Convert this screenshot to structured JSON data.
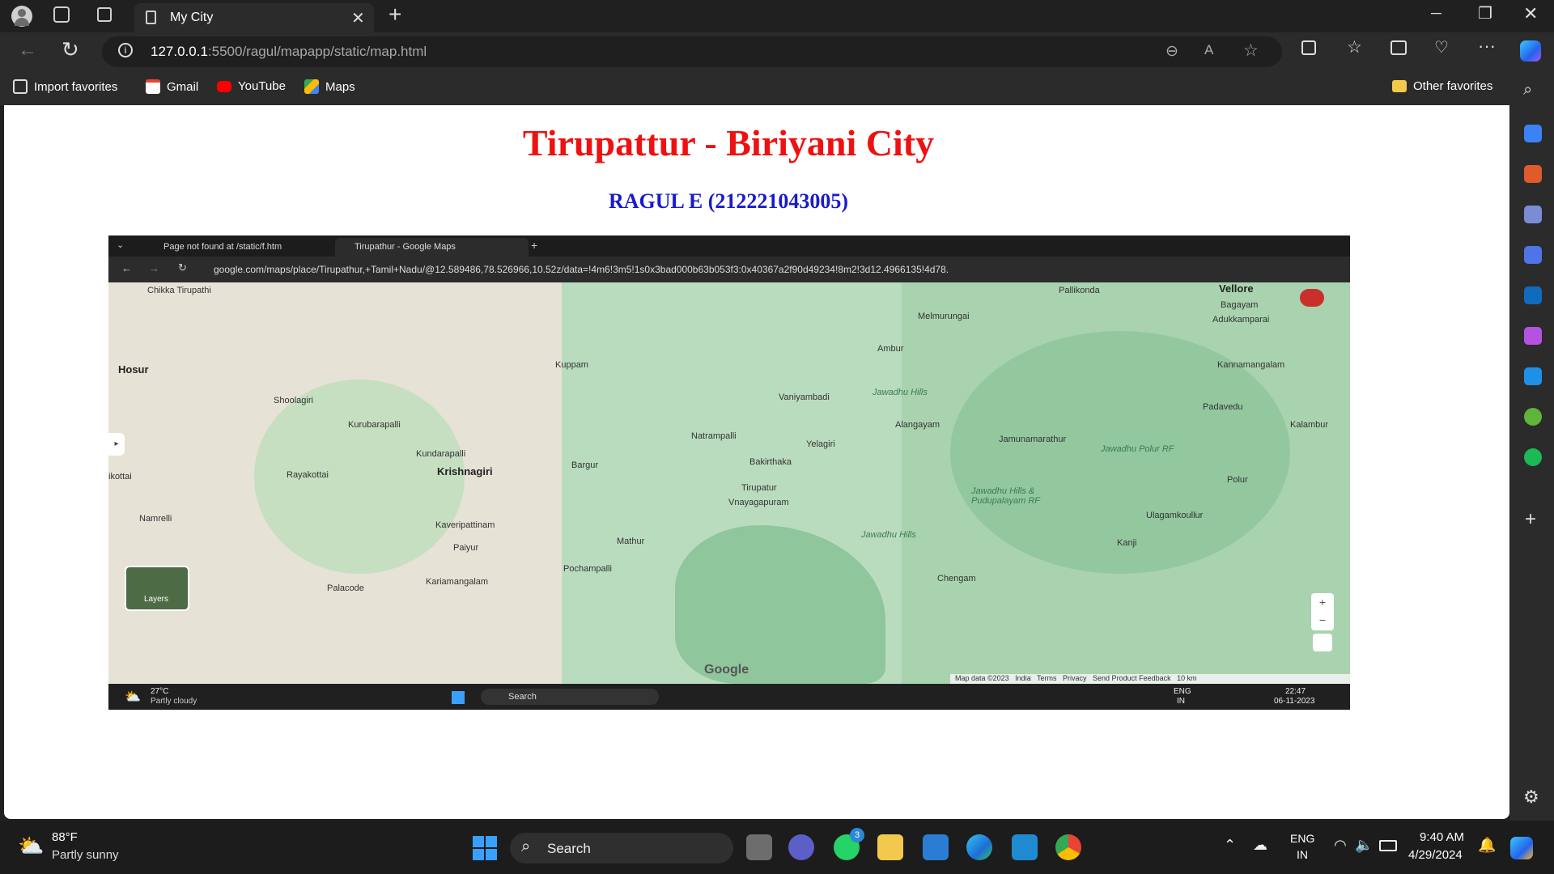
{
  "browser": {
    "tab_title": "My City",
    "url_host": "127.0.0.1",
    "url_path": ":5500/ragul/mapapp/static/map.html",
    "favorites": [
      "Import favorites",
      "Gmail",
      "YouTube",
      "Maps"
    ],
    "other_favorites": "Other favorites"
  },
  "page": {
    "heading": "Tirupattur - Biriyani City",
    "subheading": "RAGUL E (212221043005)"
  },
  "screenshot": {
    "tabs": [
      "Page not found at /static/f.htm",
      "Tirupathur - Google Maps"
    ],
    "url": "google.com/maps/place/Tirupathur,+Tamil+Nadu/@12.589486,78.526966,10.52z/data=!4m6!3m5!1s0x3bad000b63b053f3:0x40367a2f90d49234!8m2!3d12.4966135!4d78.",
    "map_labels": {
      "chikka": "Chikka Tirupathi",
      "hosur": "Hosur",
      "shoolagiri": "Shoolagiri",
      "kurubarapalli": "Kurubarapalli",
      "kundarapalli": "Kundarapalli",
      "krishnagiri": "Krishnagiri",
      "rayakottai": "Rayakottai",
      "namrelli": "Namrelli",
      "kaveripattinam": "Kaveripattinam",
      "paiyur": "Paiyur",
      "pochampalli": "Pochampalli",
      "palacode": "Palacode",
      "kariamangalam": "Kariamangalam",
      "kuppam": "Kuppam",
      "bargur": "Bargur",
      "natrampalli": "Natrampalli",
      "vaniyambadi": "Vaniyambadi",
      "yelagiri": "Yelagiri",
      "bakirthaka": "Bakirthaka",
      "tirupatur": "Tirupatur",
      "vnayagapuram": "Vnayagapuram",
      "mathur": "Mathur",
      "ambur": "Ambur",
      "melmurungai": "Melmurungai",
      "alangayam": "Alangayam",
      "jawadhu_hills": "Jawadhu Hills",
      "jamunamarathur": "Jamunamarathur",
      "jawadhu_polur": "Jawadhu Polur RF",
      "jawadhu_pudupalayam": "Jawadhu Hills & Pudupalayam RF",
      "jawadhu_hills2": "Jawadhu Hills",
      "pallikonda": "Pallikonda",
      "vellore": "Vellore",
      "bagayam": "Bagayam",
      "adukkamparai": "Adukkamparai",
      "kannamangalam": "Kannamangalam",
      "padavedu": "Padavedu",
      "kalambur": "Kalambur",
      "polur": "Polur",
      "ulagamkoullur": "Ulagamkoullur",
      "kanji": "Kanji",
      "chengam": "Chengam",
      "kilottai": "ikottai",
      "layers": "Layers",
      "google": "Google",
      "map_footer": "Map data ©2023   India   Terms   Privacy   Send Product Feedback   10 km"
    },
    "weather_temp": "27°C",
    "weather_desc": "Partly cloudy",
    "search": "Search",
    "lang": "ENG",
    "region": "IN",
    "time": "22:47",
    "date": "06-11-2023"
  },
  "taskbar": {
    "weather_temp": "88°F",
    "weather_desc": "Partly sunny",
    "search": "Search",
    "whatsapp_badge": "3",
    "lang": "ENG",
    "region": "IN",
    "time": "9:40 AM",
    "date": "4/29/2024"
  }
}
